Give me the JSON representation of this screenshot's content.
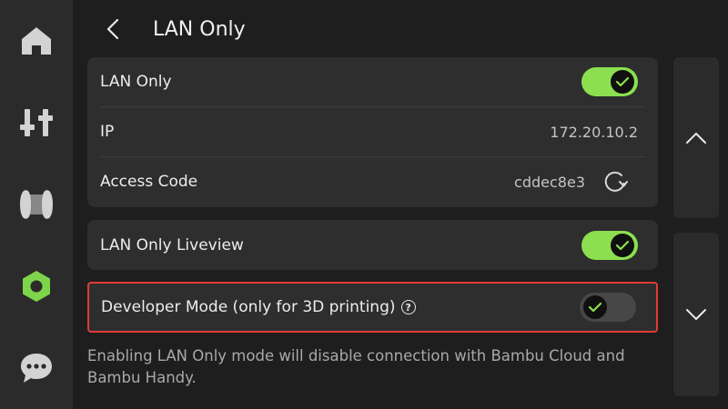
{
  "header": {
    "title": "LAN Only"
  },
  "sidebar": {
    "items": [
      {
        "icon": "home-icon",
        "active": false
      },
      {
        "icon": "sliders-icon",
        "active": false
      },
      {
        "icon": "filament-spool-icon",
        "active": false
      },
      {
        "icon": "hex-settings-icon",
        "active": true
      },
      {
        "icon": "chat-icon",
        "active": false
      }
    ]
  },
  "network": {
    "lan_only": {
      "label": "LAN Only",
      "enabled": true
    },
    "ip": {
      "label": "IP",
      "value": "172.20.10.2"
    },
    "access_code": {
      "label": "Access Code",
      "value": "cddec8e3"
    }
  },
  "liveview": {
    "label": "LAN Only Liveview",
    "enabled": true
  },
  "developer": {
    "label": "Developer Mode (only for 3D printing)",
    "enabled": false,
    "help": "?"
  },
  "note": "Enabling LAN Only mode will disable connection with Bambu Cloud and Bambu Handy.",
  "colors": {
    "accent": "#8ce04f",
    "highlight_border": "#e23a3a",
    "card": "#2e2e2e",
    "background": "#1e1e1e"
  }
}
